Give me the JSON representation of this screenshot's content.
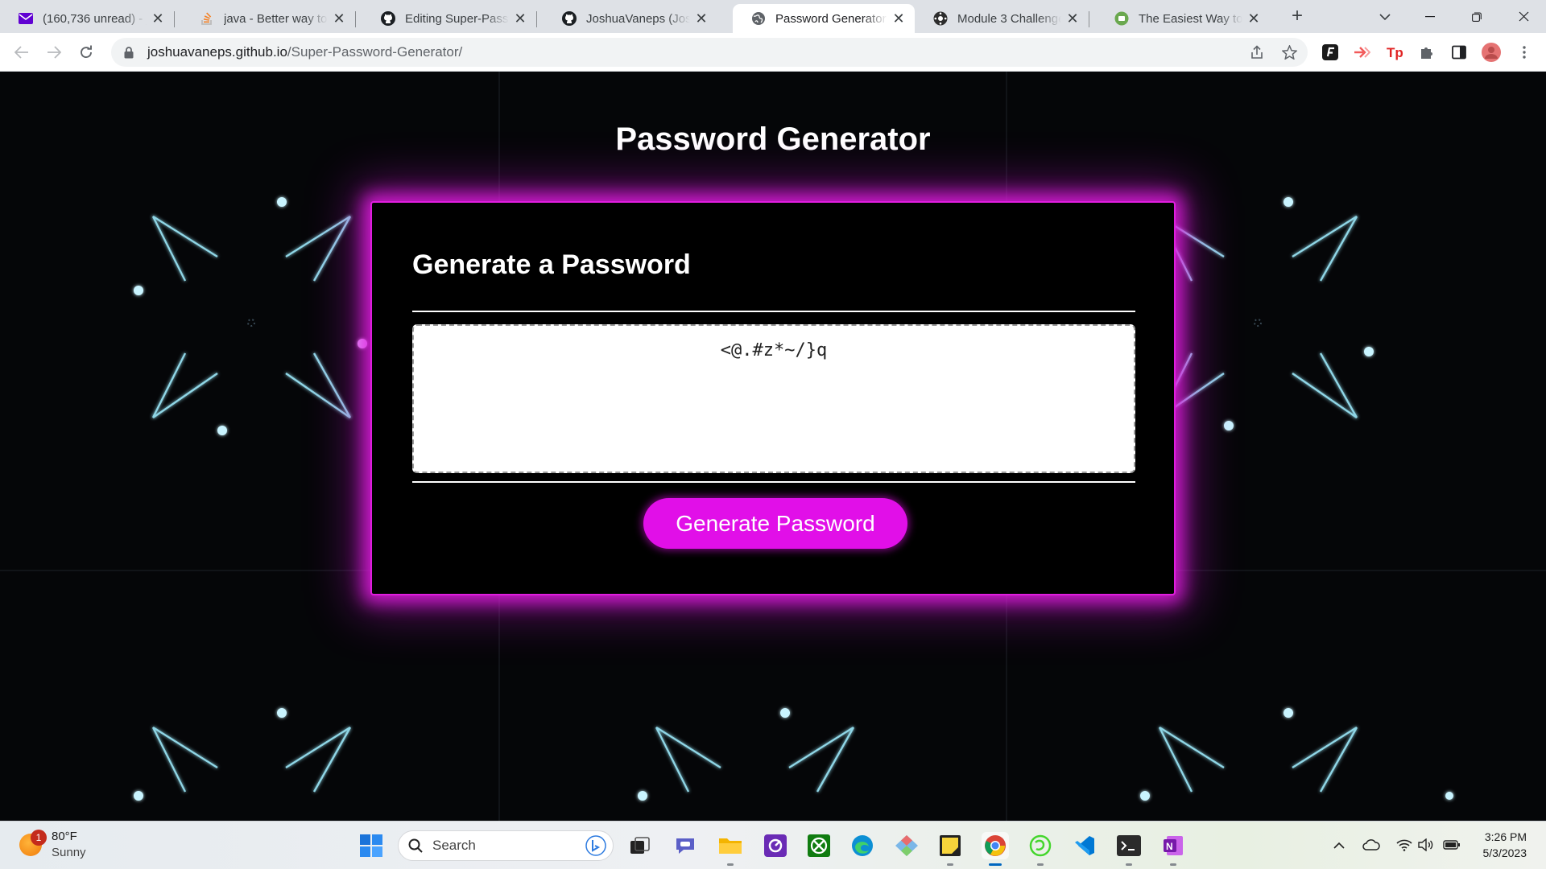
{
  "browser": {
    "tabs": [
      {
        "title": "(160,736 unread) - jos",
        "icon": "mail-icon"
      },
      {
        "title": "java - Better way to ge",
        "icon": "stackoverflow-icon"
      },
      {
        "title": "Editing Super-Passwo",
        "icon": "github-icon"
      },
      {
        "title": "JoshuaVaneps (Joshua",
        "icon": "github-icon"
      },
      {
        "title": "Password Generator",
        "icon": "globe-icon",
        "active": true
      },
      {
        "title": "Module 3 Challenge: ",
        "icon": "canvas-icon"
      },
      {
        "title": "The Easiest Way to Ta",
        "icon": "site-icon"
      }
    ],
    "address": {
      "host": "joshuavaneps.github.io",
      "path": "/Super-Password-Generator/"
    }
  },
  "page": {
    "title": "Password Generator",
    "card_heading": "Generate a Password",
    "password": "<@.#z*~/}q",
    "button_label": "Generate Password"
  },
  "taskbar": {
    "weather": {
      "badge": "1",
      "temp": "80°F",
      "condition": "Sunny"
    },
    "search_label": "Search",
    "time": "3:26 PM",
    "date": "5/3/2023"
  },
  "colors": {
    "accent": "#e10fe8",
    "glow": "#e11ddf",
    "page_bg": "#050608"
  }
}
